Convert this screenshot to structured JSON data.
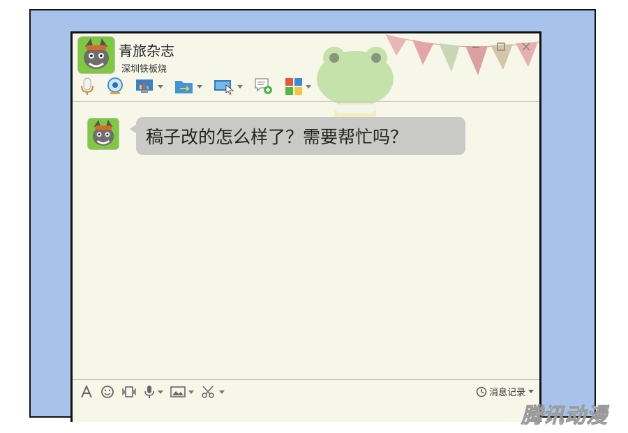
{
  "window": {
    "title": "青旅杂志",
    "subtitle": "深圳铁板烧"
  },
  "chat": {
    "messages": [
      {
        "text": "稿子改的怎么样了？需要帮忙吗？"
      }
    ]
  },
  "bottom": {
    "history_label": "消息记录"
  },
  "watermark": "腾讯动漫",
  "icons": {
    "toolbar": [
      "microphone-icon",
      "webcam-icon",
      "screen-share-icon",
      "file-transfer-icon",
      "remote-desktop-icon",
      "add-message-icon",
      "apps-icon"
    ],
    "bottom": [
      "font-icon",
      "emoji-icon",
      "shake-icon",
      "voice-icon",
      "image-icon",
      "screenshot-icon",
      "clock-icon"
    ]
  },
  "colors": {
    "panel_bg": "#a7c3ec",
    "window_bg": "#f6f7e9",
    "bubble_bg": "#c9c9c7"
  }
}
